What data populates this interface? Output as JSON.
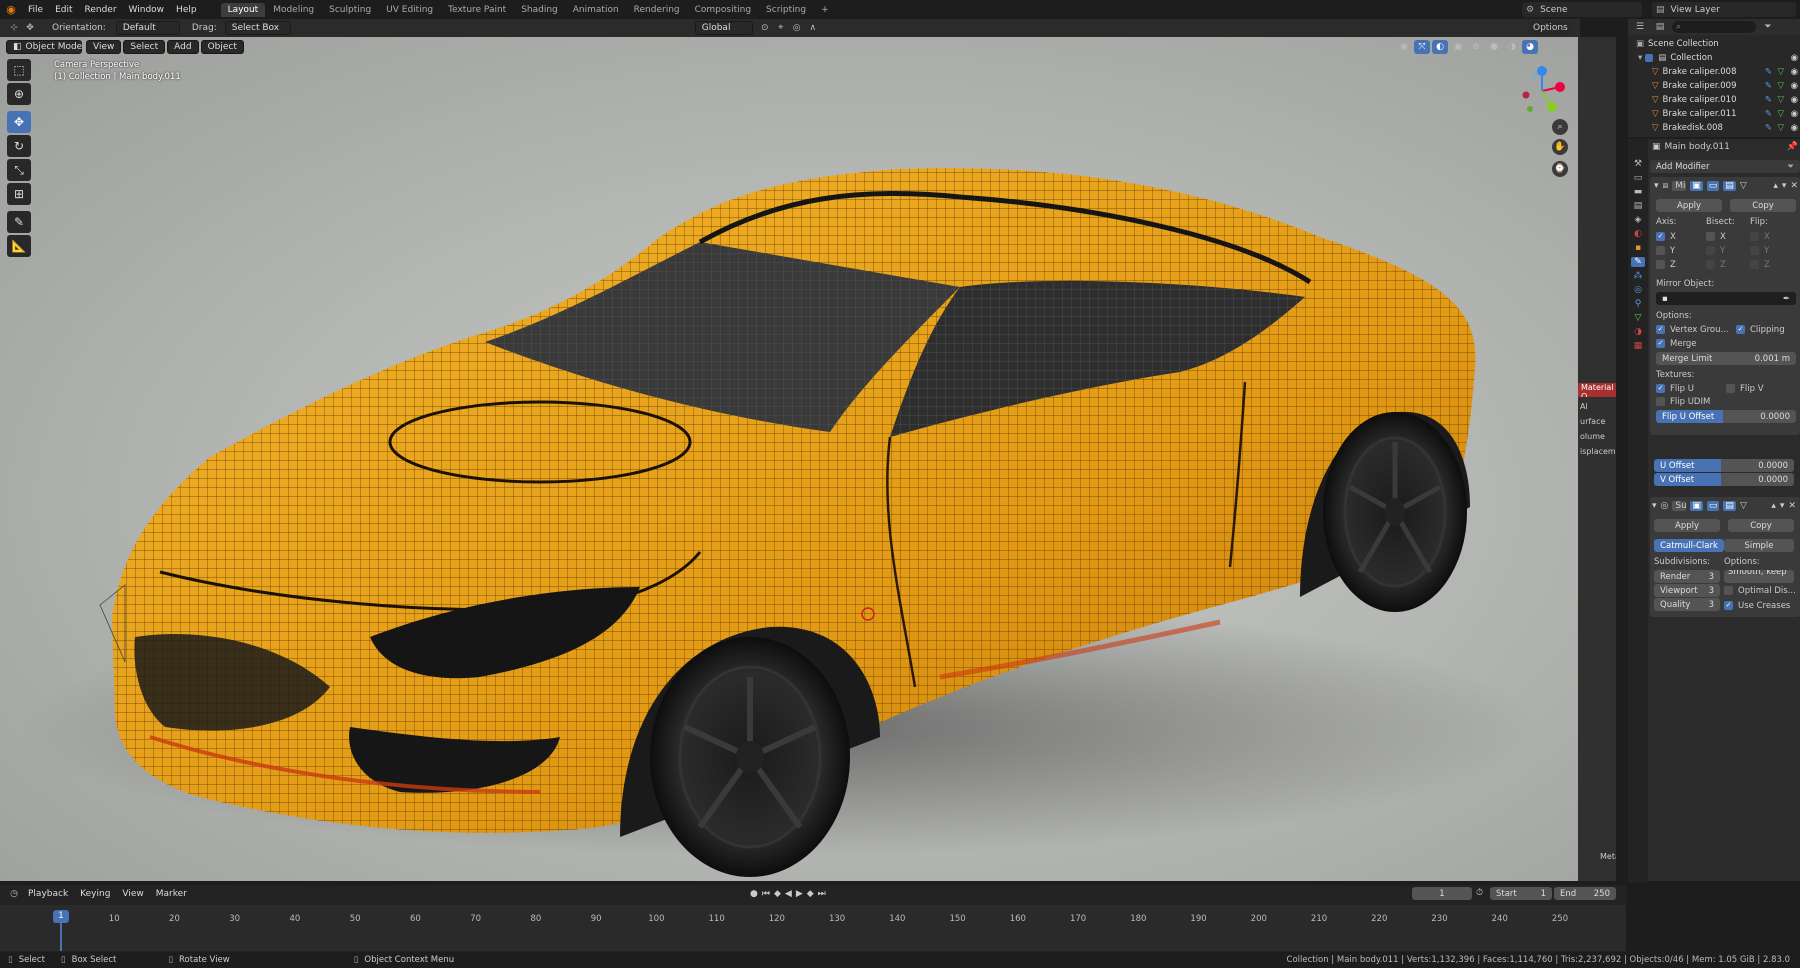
{
  "menubar": {
    "menus": [
      "File",
      "Edit",
      "Render",
      "Window",
      "Help"
    ],
    "workspaces": [
      "Layout",
      "Modeling",
      "Sculpting",
      "UV Editing",
      "Texture Paint",
      "Shading",
      "Animation",
      "Rendering",
      "Compositing",
      "Scripting"
    ],
    "add_workspace": "+",
    "scene": "Scene",
    "view_layer": "View Layer"
  },
  "tool_header": {
    "orientation_label": "Orientation:",
    "orientation_value": "Default",
    "drag_label": "Drag:",
    "drag_value": "Select Box",
    "transform": "Global",
    "options": "Options"
  },
  "viewport_header": {
    "mode": "Object Mode",
    "menus": [
      "View",
      "Select",
      "Add",
      "Object"
    ]
  },
  "viewport": {
    "camera_label": "Camera Perspective",
    "collection_label": "(1) Collection | Main body.011",
    "partial_panel": {
      "tab_label": "Material O",
      "lines": [
        "Al",
        "urface",
        "olume",
        "isplacemen"
      ],
      "meta": "Meta"
    }
  },
  "outliner": {
    "search_placeholder": "",
    "scene_collection": "Scene Collection",
    "collection": "Collection",
    "items": [
      "Brake caliper.008",
      "Brake caliper.009",
      "Brake caliper.010",
      "Brake caliper.011",
      "Brakedisk.008"
    ]
  },
  "properties": {
    "object_name": "Main body.011",
    "add_modifier": "Add Modifier",
    "mirror": {
      "name": "Mi",
      "apply": "Apply",
      "copy": "Copy",
      "axis_label": "Axis:",
      "bisect_label": "Bisect:",
      "flip_label": "Flip:",
      "axes": [
        "X",
        "Y",
        "Z"
      ],
      "mirror_object_label": "Mirror Object:",
      "options_label": "Options:",
      "vertex_groups": "Vertex Grou...",
      "clipping": "Clipping",
      "merge": "Merge",
      "merge_limit_label": "Merge Limit",
      "merge_limit_value": "0.001 m",
      "textures_label": "Textures:",
      "flip_u": "Flip U",
      "flip_v": "Flip V",
      "flip_udim": "Flip UDIM",
      "flip_u_offset_label": "Flip U Offset",
      "flip_u_offset_value": "0.0000",
      "u_offset_label": "U Offset",
      "u_offset_value": "0.0000",
      "v_offset_label": "V Offset",
      "v_offset_value": "0.0000"
    },
    "subsurf": {
      "name": "Su",
      "apply": "Apply",
      "copy": "Copy",
      "catmull": "Catmull-Clark",
      "simple": "Simple",
      "subdivisions_label": "Subdivisions:",
      "options_label": "Options:",
      "render_label": "Render",
      "render_value": "3",
      "viewport_label": "Viewport",
      "viewport_value": "3",
      "quality_label": "Quality",
      "quality_value": "3",
      "uv_smooth": "Smooth, keep ...",
      "optimal_display": "Optimal Dis...",
      "use_creases": "Use Creases"
    }
  },
  "timeline": {
    "menus": [
      "Playback",
      "Keying",
      "View",
      "Marker"
    ],
    "current_frame": "1",
    "start_label": "Start",
    "start_value": "1",
    "end_label": "End",
    "end_value": "250",
    "ticks": [
      "1",
      "10",
      "20",
      "30",
      "40",
      "50",
      "60",
      "70",
      "80",
      "90",
      "100",
      "110",
      "120",
      "130",
      "140",
      "150",
      "160",
      "170",
      "180",
      "190",
      "200",
      "210",
      "220",
      "230",
      "240",
      "250"
    ]
  },
  "statusbar": {
    "select": "Select",
    "box_select": "Box Select",
    "rotate_view": "Rotate View",
    "context_menu": "Object Context Menu",
    "stats": "Collection | Main body.011 | Verts:1,132,396 | Faces:1,114,760 | Tris:2,237,692 | Objects:0/46 | Mem: 1.05 GiB | 2.83.0"
  },
  "colors": {
    "accent": "#4772b3",
    "car_body": "#e8a21a",
    "viewport_bg": "#b6b8b5"
  }
}
